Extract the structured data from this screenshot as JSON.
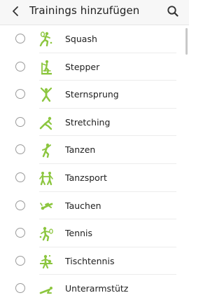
{
  "header": {
    "title": "Trainings hinzufügen",
    "back_icon": "back-arrow-icon",
    "search_icon": "search-icon"
  },
  "colors": {
    "accent_green": "#8cc63f",
    "text": "#212121",
    "radio_border": "#9a9a9a"
  },
  "activities": [
    {
      "label": "Squash",
      "icon": "squash-icon",
      "selected": false
    },
    {
      "label": "Stepper",
      "icon": "stepper-icon",
      "selected": false
    },
    {
      "label": "Sternsprung",
      "icon": "sternsprung-icon",
      "selected": false
    },
    {
      "label": "Stretching",
      "icon": "stretching-icon",
      "selected": false
    },
    {
      "label": "Tanzen",
      "icon": "tanzen-icon",
      "selected": false
    },
    {
      "label": "Tanzsport",
      "icon": "tanzsport-icon",
      "selected": false
    },
    {
      "label": "Tauchen",
      "icon": "tauchen-icon",
      "selected": false
    },
    {
      "label": "Tennis",
      "icon": "tennis-icon",
      "selected": false
    },
    {
      "label": "Tischtennis",
      "icon": "tischtennis-icon",
      "selected": false
    },
    {
      "label": "Unterarmstütz",
      "icon": "unterarmstuetz-icon",
      "selected": false
    }
  ]
}
